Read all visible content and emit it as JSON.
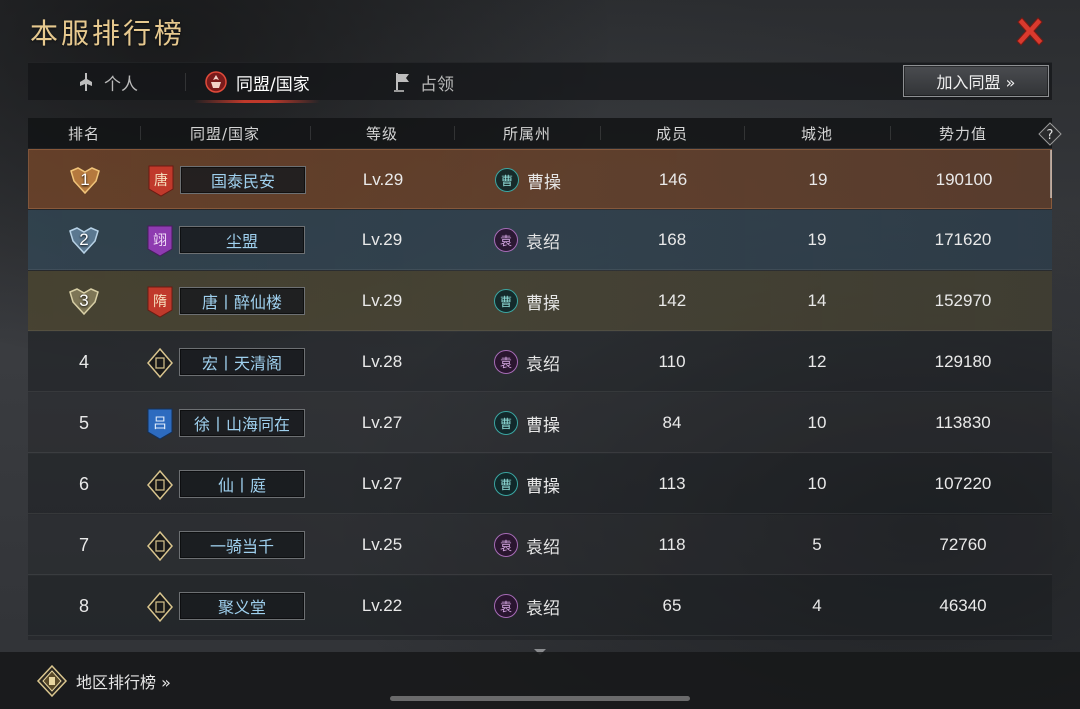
{
  "header": {
    "title": "本服排行榜"
  },
  "tabs": [
    {
      "label": "个人",
      "icon": "person-flag-icon",
      "active": false
    },
    {
      "label": "同盟/国家",
      "icon": "alliance-emblem-icon",
      "active": true
    },
    {
      "label": "占领",
      "icon": "territory-flag-icon",
      "active": false
    }
  ],
  "join_button": {
    "label": "加入同盟 »"
  },
  "table": {
    "columns": [
      "排名",
      "同盟/国家",
      "等级",
      "所属州",
      "成员",
      "城池",
      "势力值"
    ],
    "rows": [
      {
        "rank": "1",
        "flag_char": "唐",
        "flag_color": "#c0392b",
        "name": "国泰民安",
        "level": "Lv.29",
        "state": "曹操",
        "state_glyph": "曹",
        "members": "146",
        "cities": "19",
        "power": "190100"
      },
      {
        "rank": "2",
        "flag_char": "翊",
        "flag_color": "#8e3bb0",
        "name": "尘盟",
        "level": "Lv.29",
        "state": "袁绍",
        "state_glyph": "袁",
        "members": "168",
        "cities": "19",
        "power": "171620"
      },
      {
        "rank": "3",
        "flag_char": "隋",
        "flag_color": "#c0392b",
        "name": "唐丨醉仙楼",
        "level": "Lv.29",
        "state": "曹操",
        "state_glyph": "曹",
        "members": "142",
        "cities": "14",
        "power": "152970"
      },
      {
        "rank": "4",
        "flag_char": "",
        "flag_color": "#1a1a1a",
        "name": "宏丨天清阁",
        "level": "Lv.28",
        "state": "袁绍",
        "state_glyph": "袁",
        "members": "110",
        "cities": "12",
        "power": "129180"
      },
      {
        "rank": "5",
        "flag_char": "吕",
        "flag_color": "#2d6bbf",
        "name": "徐丨山海同在",
        "level": "Lv.27",
        "state": "曹操",
        "state_glyph": "曹",
        "members": "84",
        "cities": "10",
        "power": "113830"
      },
      {
        "rank": "6",
        "flag_char": "",
        "flag_color": "#1a1a1a",
        "name": "仙丨庭",
        "level": "Lv.27",
        "state": "曹操",
        "state_glyph": "曹",
        "members": "113",
        "cities": "10",
        "power": "107220"
      },
      {
        "rank": "7",
        "flag_char": "",
        "flag_color": "#1a1a1a",
        "name": "一骑当千",
        "level": "Lv.25",
        "state": "袁绍",
        "state_glyph": "袁",
        "members": "118",
        "cities": "5",
        "power": "72760"
      },
      {
        "rank": "8",
        "flag_char": "",
        "flag_color": "#1a1a1a",
        "name": "聚义堂",
        "level": "Lv.22",
        "state": "袁绍",
        "state_glyph": "袁",
        "members": "65",
        "cities": "4",
        "power": "46340"
      }
    ]
  },
  "footer": {
    "region_link": "地区排行榜 »",
    "region_icon": "region-emblem-icon"
  },
  "colors": {
    "title_gold": "#e7c98f",
    "close_red": "#d93a2e",
    "name_blue": "#9fd0ee",
    "tab_underline": "#c0392b"
  }
}
